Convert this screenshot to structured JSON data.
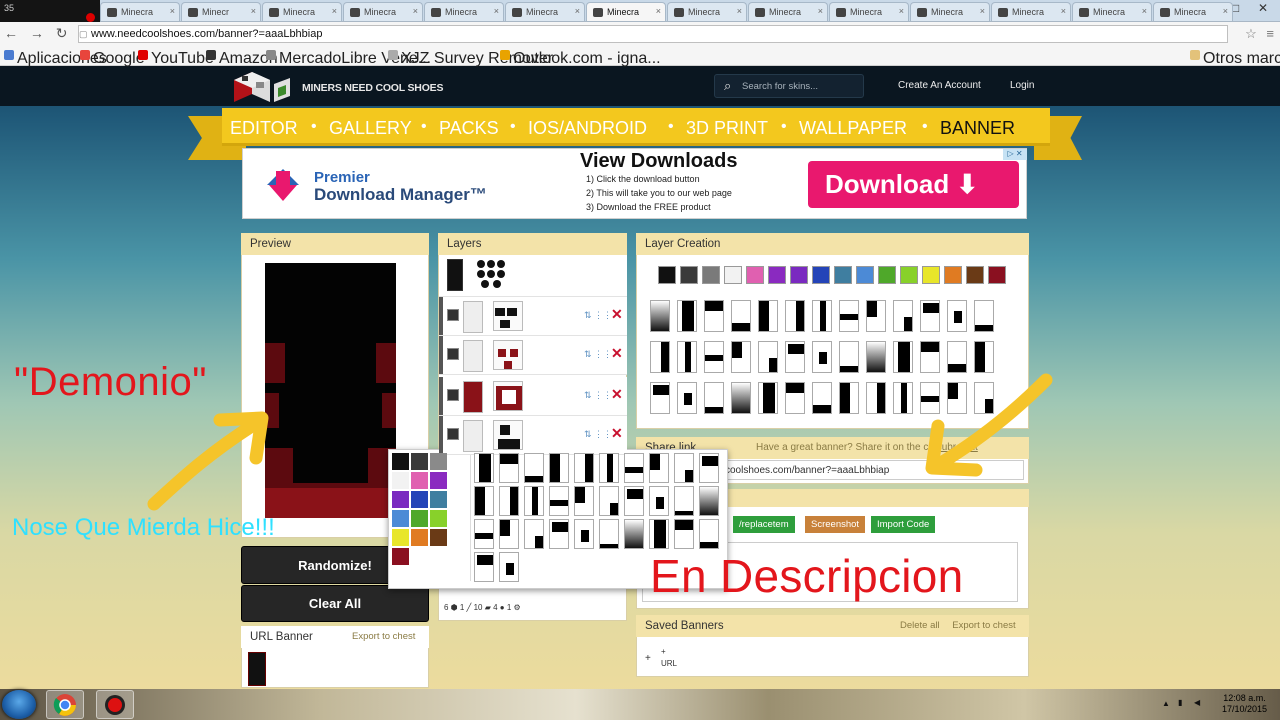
{
  "recorder": {
    "label": "35"
  },
  "browser": {
    "tabs": [
      {
        "label": "Minecra"
      },
      {
        "label": "Minecr"
      },
      {
        "label": "Minecra"
      },
      {
        "label": "Minecra"
      },
      {
        "label": "Minecra"
      },
      {
        "label": "Minecra"
      },
      {
        "label": "Minecra",
        "active": true
      },
      {
        "label": "Minecra"
      },
      {
        "label": "Minecra"
      },
      {
        "label": "Minecra"
      },
      {
        "label": "Minecra"
      },
      {
        "label": "Minecra"
      },
      {
        "label": "Minecra"
      },
      {
        "label": "Minecra"
      }
    ],
    "url": "www.needcoolshoes.com/banner?=aaaLbhbiap",
    "bookmarks": [
      {
        "label": "Aplicaciones",
        "color": "#4a7bd0"
      },
      {
        "label": "Google",
        "color": "#e8453c"
      },
      {
        "label": "YouTube",
        "color": "#e00000"
      },
      {
        "label": "Amazon",
        "color": "#333333"
      },
      {
        "label": "MercadoLibre Vene...",
        "color": "#888888"
      },
      {
        "label": "XJZ Survey Remover",
        "color": "#aaaaaa"
      },
      {
        "label": "Outlook.com - igna...",
        "color": "#e9a300"
      }
    ],
    "other_bookmarks": "Otros marcadores"
  },
  "site": {
    "brand": "MINERS NEED COOL SHOES",
    "search_placeholder": "Search for skins...",
    "create_account": "Create An Account",
    "login": "Login",
    "nav": [
      "EDITOR",
      "GALLERY",
      "PACKS",
      "IOS/ANDROID",
      "3D PRINT",
      "WALLPAPER",
      "BANNER"
    ],
    "active_nav": "BANNER"
  },
  "ad": {
    "brand_line1": "Premier",
    "brand_line2": "Download Manager™",
    "title": "View Downloads",
    "steps": [
      "1) Click the download button",
      "2) This will take you to our web page",
      "3) Download the FREE product"
    ],
    "button": "Download ⬇",
    "close": "▷ ✕"
  },
  "panels": {
    "preview": "Preview",
    "layers": "Layers",
    "layer_creation": "Layer Creation",
    "share_link": "Share link",
    "share_hint": "Have a great banner? Share it on the co",
    "share_hint_link": "subreddit",
    "share_url": "coolshoes.com/banner?=aaaLbhbiap",
    "buttons": [
      {
        "label": "/replacetem",
        "color": "#2e9e3c"
      },
      {
        "label": "Screenshot",
        "color": "#c8813a"
      },
      {
        "label": "Import Code",
        "color": "#2e9e3c"
      }
    ],
    "randomize": "Randomize!",
    "clear_all": "Clear All",
    "url_banner": "URL Banner",
    "url_export": "Export to chest",
    "saved_banners": "Saved Banners",
    "delete_all": "Delete all",
    "export_chest": "Export to chest",
    "saved_thumb_label": "URL",
    "layer_counts": "6 ⬢  1 ╱  10 ▰  4 ●  1 ⚙"
  },
  "palette": [
    "#111111",
    "#3a3a3a",
    "#7a7a7a",
    "#f2f2f2",
    "#e060b0",
    "#8a2ac0",
    "#7a2ac0",
    "#2444b8",
    "#3f7ea0",
    "#4c8ad6",
    "#4fa82a",
    "#88d12a",
    "#e8e62a",
    "#e07b22",
    "#6a3a16",
    "#8a1020"
  ],
  "overlays": {
    "demonio": "\"Demonio\"",
    "nose": "Nose Que Mierda Hice!!!",
    "en_descripcion": "En Descripcion"
  },
  "taskbar": {
    "time": "12:08 a.m.",
    "date": "17/10/2015"
  }
}
